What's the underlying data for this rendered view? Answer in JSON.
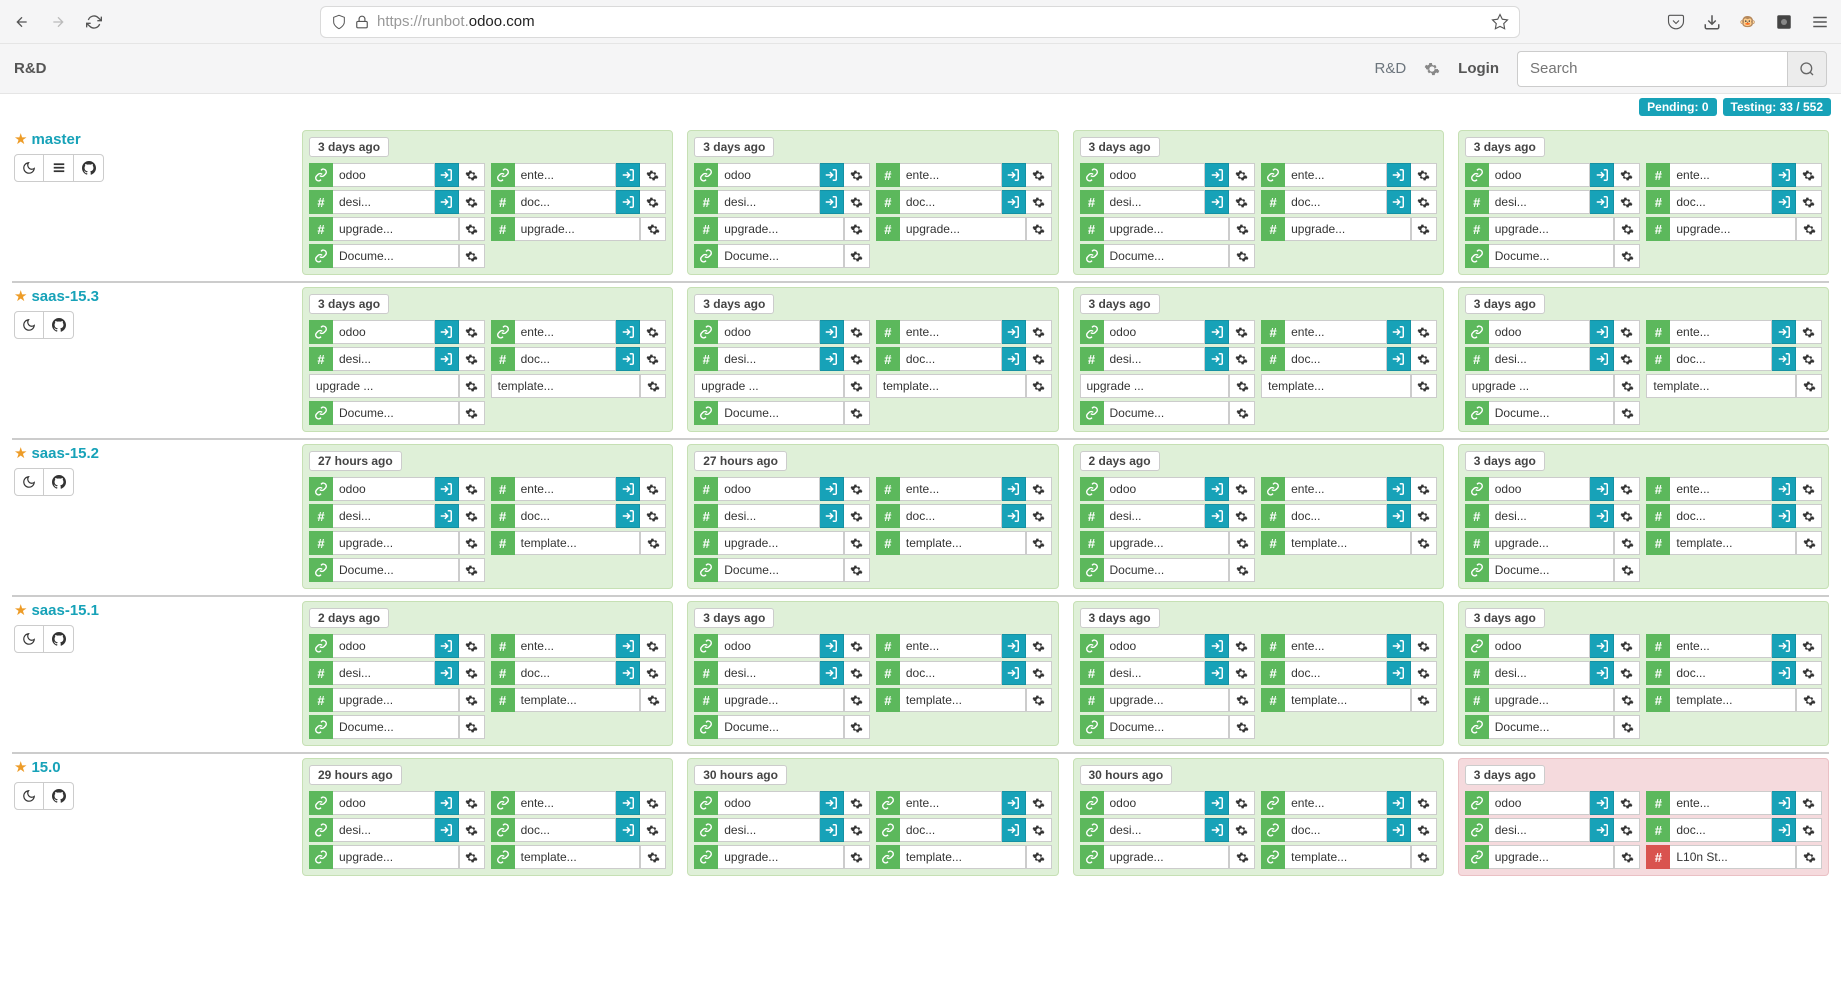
{
  "url": {
    "scheme": "https://",
    "sub": "runbot.",
    "domain": "odoo.com"
  },
  "brand": "R&D",
  "header": {
    "rd": "R&D",
    "login": "Login",
    "search_placeholder": "Search"
  },
  "status": {
    "pending": "Pending: 0",
    "testing": "Testing: 33 / 552"
  },
  "branches": [
    {
      "name": "master",
      "side_btns": [
        "moon",
        "bars",
        "github"
      ],
      "builds": [
        {
          "time": "3 days ago",
          "left": [
            {
              "i": "link",
              "t": "odoo",
              "a": true
            },
            {
              "i": "hash",
              "t": "desi...",
              "a": true
            },
            {
              "i": "hash",
              "t": "upgrade...",
              "g": true
            },
            {
              "i": "link",
              "t": "Docume...",
              "g": true
            }
          ],
          "right": [
            {
              "i": "link",
              "t": "ente...",
              "a": true
            },
            {
              "i": "hash",
              "t": "doc...",
              "a": true
            },
            {
              "i": "hash",
              "t": "upgrade...",
              "g": true
            }
          ]
        },
        {
          "time": "3 days ago",
          "left": [
            {
              "i": "link",
              "t": "odoo",
              "a": true
            },
            {
              "i": "hash",
              "t": "desi...",
              "a": true
            },
            {
              "i": "hash",
              "t": "upgrade...",
              "g": true
            },
            {
              "i": "link",
              "t": "Docume...",
              "g": true
            }
          ],
          "right": [
            {
              "i": "hash",
              "t": "ente...",
              "a": true
            },
            {
              "i": "hash",
              "t": "doc...",
              "a": true
            },
            {
              "i": "hash",
              "t": "upgrade...",
              "g": true
            }
          ]
        },
        {
          "time": "3 days ago",
          "left": [
            {
              "i": "link",
              "t": "odoo",
              "a": true
            },
            {
              "i": "hash",
              "t": "desi...",
              "a": true
            },
            {
              "i": "hash",
              "t": "upgrade...",
              "g": true
            },
            {
              "i": "link",
              "t": "Docume...",
              "g": true
            }
          ],
          "right": [
            {
              "i": "link",
              "t": "ente...",
              "a": true
            },
            {
              "i": "hash",
              "t": "doc...",
              "a": true
            },
            {
              "i": "hash",
              "t": "upgrade...",
              "g": true
            }
          ]
        },
        {
          "time": "3 days ago",
          "left": [
            {
              "i": "link",
              "t": "odoo",
              "a": true
            },
            {
              "i": "hash",
              "t": "desi...",
              "a": true
            },
            {
              "i": "hash",
              "t": "upgrade...",
              "g": true
            },
            {
              "i": "link",
              "t": "Docume...",
              "g": true
            }
          ],
          "right": [
            {
              "i": "hash",
              "t": "ente...",
              "a": true
            },
            {
              "i": "hash",
              "t": "doc...",
              "a": true
            },
            {
              "i": "hash",
              "t": "upgrade...",
              "g": true
            }
          ]
        }
      ]
    },
    {
      "name": "saas-15.3",
      "side_btns": [
        "moon",
        "github"
      ],
      "builds": [
        {
          "time": "3 days ago",
          "left": [
            {
              "i": "link",
              "t": "odoo",
              "a": true
            },
            {
              "i": "hash",
              "t": "desi...",
              "a": true
            },
            {
              "t": "upgrade ...",
              "g": true,
              "plain": true
            },
            {
              "i": "link",
              "t": "Docume...",
              "g": true
            }
          ],
          "right": [
            {
              "i": "link",
              "t": "ente...",
              "a": true
            },
            {
              "i": "hash",
              "t": "doc...",
              "a": true
            },
            {
              "t": "template...",
              "g": true,
              "plain": true
            }
          ]
        },
        {
          "time": "3 days ago",
          "left": [
            {
              "i": "link",
              "t": "odoo",
              "a": true
            },
            {
              "i": "hash",
              "t": "desi...",
              "a": true
            },
            {
              "t": "upgrade ...",
              "g": true,
              "plain": true
            },
            {
              "i": "link",
              "t": "Docume...",
              "g": true
            }
          ],
          "right": [
            {
              "i": "hash",
              "t": "ente...",
              "a": true
            },
            {
              "i": "hash",
              "t": "doc...",
              "a": true
            },
            {
              "t": "template...",
              "g": true,
              "plain": true
            }
          ]
        },
        {
          "time": "3 days ago",
          "left": [
            {
              "i": "link",
              "t": "odoo",
              "a": true
            },
            {
              "i": "hash",
              "t": "desi...",
              "a": true
            },
            {
              "t": "upgrade ...",
              "g": true,
              "plain": true
            },
            {
              "i": "link",
              "t": "Docume...",
              "g": true
            }
          ],
          "right": [
            {
              "i": "hash",
              "t": "ente...",
              "a": true
            },
            {
              "i": "hash",
              "t": "doc...",
              "a": true
            },
            {
              "t": "template...",
              "g": true,
              "plain": true
            }
          ]
        },
        {
          "time": "3 days ago",
          "left": [
            {
              "i": "link",
              "t": "odoo",
              "a": true
            },
            {
              "i": "hash",
              "t": "desi...",
              "a": true
            },
            {
              "t": "upgrade ...",
              "g": true,
              "plain": true
            },
            {
              "i": "link",
              "t": "Docume...",
              "g": true
            }
          ],
          "right": [
            {
              "i": "hash",
              "t": "ente...",
              "a": true
            },
            {
              "i": "hash",
              "t": "doc...",
              "a": true
            },
            {
              "t": "template...",
              "g": true,
              "plain": true
            }
          ]
        }
      ]
    },
    {
      "name": "saas-15.2",
      "side_btns": [
        "moon",
        "github"
      ],
      "builds": [
        {
          "time": "27 hours ago",
          "left": [
            {
              "i": "link",
              "t": "odoo",
              "a": true
            },
            {
              "i": "hash",
              "t": "desi...",
              "a": true
            },
            {
              "i": "hash",
              "t": "upgrade...",
              "g": true
            },
            {
              "i": "link",
              "t": "Docume...",
              "g": true
            }
          ],
          "right": [
            {
              "i": "hash",
              "t": "ente...",
              "a": true
            },
            {
              "i": "hash",
              "t": "doc...",
              "a": true
            },
            {
              "i": "hash",
              "t": "template...",
              "g": true
            }
          ]
        },
        {
          "time": "27 hours ago",
          "left": [
            {
              "i": "hash",
              "t": "odoo",
              "a": true
            },
            {
              "i": "hash",
              "t": "desi...",
              "a": true
            },
            {
              "i": "hash",
              "t": "upgrade...",
              "g": true
            },
            {
              "i": "link",
              "t": "Docume...",
              "g": true
            }
          ],
          "right": [
            {
              "i": "hash",
              "t": "ente...",
              "a": true
            },
            {
              "i": "hash",
              "t": "doc...",
              "a": true
            },
            {
              "i": "hash",
              "t": "template...",
              "g": true
            }
          ]
        },
        {
          "time": "2 days ago",
          "left": [
            {
              "i": "link",
              "t": "odoo",
              "a": true
            },
            {
              "i": "hash",
              "t": "desi...",
              "a": true
            },
            {
              "i": "hash",
              "t": "upgrade...",
              "g": true
            },
            {
              "i": "link",
              "t": "Docume...",
              "g": true
            }
          ],
          "right": [
            {
              "i": "link",
              "t": "ente...",
              "a": true
            },
            {
              "i": "hash",
              "t": "doc...",
              "a": true
            },
            {
              "i": "hash",
              "t": "template...",
              "g": true
            }
          ]
        },
        {
          "time": "3 days ago",
          "left": [
            {
              "i": "link",
              "t": "odoo",
              "a": true
            },
            {
              "i": "hash",
              "t": "desi...",
              "a": true
            },
            {
              "i": "hash",
              "t": "upgrade...",
              "g": true
            },
            {
              "i": "link",
              "t": "Docume...",
              "g": true
            }
          ],
          "right": [
            {
              "i": "hash",
              "t": "ente...",
              "a": true
            },
            {
              "i": "hash",
              "t": "doc...",
              "a": true
            },
            {
              "i": "hash",
              "t": "template...",
              "g": true
            }
          ]
        }
      ]
    },
    {
      "name": "saas-15.1",
      "side_btns": [
        "moon",
        "github"
      ],
      "builds": [
        {
          "time": "2 days ago",
          "left": [
            {
              "i": "link",
              "t": "odoo",
              "a": true
            },
            {
              "i": "hash",
              "t": "desi...",
              "a": true
            },
            {
              "i": "hash",
              "t": "upgrade...",
              "g": true
            },
            {
              "i": "link",
              "t": "Docume...",
              "g": true
            }
          ],
          "right": [
            {
              "i": "hash",
              "t": "ente...",
              "a": true
            },
            {
              "i": "hash",
              "t": "doc...",
              "a": true
            },
            {
              "i": "hash",
              "t": "template...",
              "g": true
            }
          ]
        },
        {
          "time": "3 days ago",
          "left": [
            {
              "i": "link",
              "t": "odoo",
              "a": true
            },
            {
              "i": "hash",
              "t": "desi...",
              "a": true
            },
            {
              "i": "hash",
              "t": "upgrade...",
              "g": true
            },
            {
              "i": "link",
              "t": "Docume...",
              "g": true
            }
          ],
          "right": [
            {
              "i": "hash",
              "t": "ente...",
              "a": true
            },
            {
              "i": "hash",
              "t": "doc...",
              "a": true
            },
            {
              "i": "hash",
              "t": "template...",
              "g": true
            }
          ]
        },
        {
          "time": "3 days ago",
          "left": [
            {
              "i": "link",
              "t": "odoo",
              "a": true
            },
            {
              "i": "hash",
              "t": "desi...",
              "a": true
            },
            {
              "i": "hash",
              "t": "upgrade...",
              "g": true
            },
            {
              "i": "link",
              "t": "Docume...",
              "g": true
            }
          ],
          "right": [
            {
              "i": "hash",
              "t": "ente...",
              "a": true
            },
            {
              "i": "hash",
              "t": "doc...",
              "a": true
            },
            {
              "i": "hash",
              "t": "template...",
              "g": true
            }
          ]
        },
        {
          "time": "3 days ago",
          "left": [
            {
              "i": "link",
              "t": "odoo",
              "a": true
            },
            {
              "i": "hash",
              "t": "desi...",
              "a": true
            },
            {
              "i": "hash",
              "t": "upgrade...",
              "g": true
            },
            {
              "i": "link",
              "t": "Docume...",
              "g": true
            }
          ],
          "right": [
            {
              "i": "hash",
              "t": "ente...",
              "a": true
            },
            {
              "i": "hash",
              "t": "doc...",
              "a": true
            },
            {
              "i": "hash",
              "t": "template...",
              "g": true
            }
          ]
        }
      ]
    },
    {
      "name": "15.0",
      "side_btns": [
        "moon",
        "github"
      ],
      "builds": [
        {
          "time": "29 hours ago",
          "left": [
            {
              "i": "link",
              "t": "odoo",
              "a": true
            },
            {
              "i": "link",
              "t": "desi...",
              "a": true
            },
            {
              "i": "link",
              "t": "upgrade...",
              "g": true
            }
          ],
          "right": [
            {
              "i": "link",
              "t": "ente...",
              "a": true
            },
            {
              "i": "link",
              "t": "doc...",
              "a": true
            },
            {
              "i": "link",
              "t": "template...",
              "g": true
            }
          ]
        },
        {
          "time": "30 hours ago",
          "left": [
            {
              "i": "link",
              "t": "odoo",
              "a": true
            },
            {
              "i": "link",
              "t": "desi...",
              "a": true
            },
            {
              "i": "link",
              "t": "upgrade...",
              "g": true
            }
          ],
          "right": [
            {
              "i": "link",
              "t": "ente...",
              "a": true
            },
            {
              "i": "link",
              "t": "doc...",
              "a": true
            },
            {
              "i": "link",
              "t": "template...",
              "g": true
            }
          ]
        },
        {
          "time": "30 hours ago",
          "left": [
            {
              "i": "link",
              "t": "odoo",
              "a": true
            },
            {
              "i": "link",
              "t": "desi...",
              "a": true
            },
            {
              "i": "link",
              "t": "upgrade...",
              "g": true
            }
          ],
          "right": [
            {
              "i": "link",
              "t": "ente...",
              "a": true
            },
            {
              "i": "link",
              "t": "doc...",
              "a": true
            },
            {
              "i": "link",
              "t": "template...",
              "g": true
            }
          ]
        },
        {
          "time": "3 days ago",
          "fail": true,
          "left": [
            {
              "i": "link",
              "t": "odoo",
              "a": true
            },
            {
              "i": "link",
              "t": "desi...",
              "a": true
            },
            {
              "i": "link",
              "t": "upgrade...",
              "g": true
            }
          ],
          "right": [
            {
              "i": "hash",
              "t": "ente...",
              "a": true
            },
            {
              "i": "hash",
              "t": "doc...",
              "a": true
            },
            {
              "i": "hash-r",
              "t": "L10n St...",
              "g": true
            }
          ]
        }
      ]
    }
  ]
}
